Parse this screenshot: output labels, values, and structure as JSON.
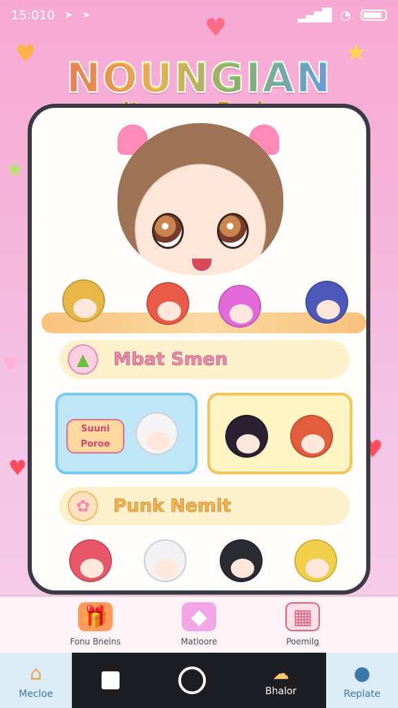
{
  "status_bar": {
    "time": "15:010",
    "arrow1": "➤",
    "arrow2": "➤"
  },
  "title": {
    "main": "NOUNGIAN",
    "sub": "Iteanas Barls"
  },
  "menu": {
    "item1": {
      "label": "Mbat Smen",
      "icon": "triangle-icon"
    },
    "item2": {
      "label": "Punk Nemit",
      "icon": "flower-icon"
    }
  },
  "tile_a": {
    "bubble_text": "Suuni Poroe"
  },
  "app_bar": [
    {
      "label": "Fonu Bneins",
      "icon": "gift-icon"
    },
    {
      "label": "Matloore",
      "icon": "gem-icon"
    },
    {
      "label": "Poemilg",
      "icon": "tablet-icon"
    }
  ],
  "nav": {
    "home_label": "Mecloe",
    "app_label": "Bhalor",
    "profile_label": "Replate"
  },
  "colors": {
    "accent_pink": "#f7a9d3",
    "border_dark": "#3a3a44"
  }
}
